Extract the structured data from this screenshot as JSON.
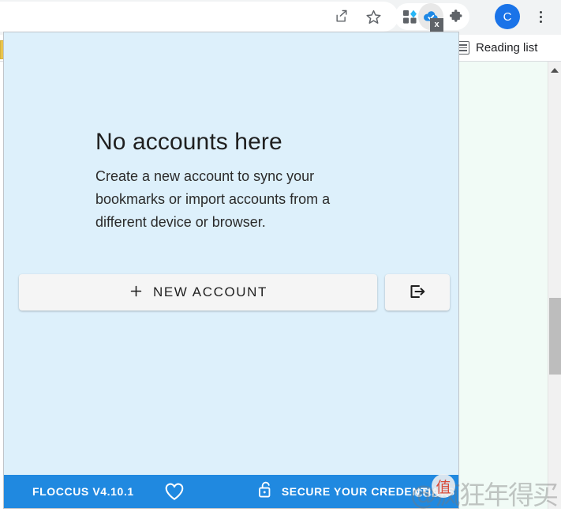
{
  "browser": {
    "toolbar": {
      "share_icon": "share-icon",
      "bookmark_star_icon": "star-icon",
      "apps_grid_icon": "apps-grid-icon",
      "floccus_extension_icon": "floccus-cloud-check-icon",
      "floccus_badge_text": "x",
      "extensions_puzzle_icon": "puzzle-icon",
      "profile_avatar_initial": "C",
      "menu_icon": "kebab-menu-icon"
    },
    "bookmarks_bar": {
      "reading_list_label": "Reading list",
      "reading_list_icon": "list-icon"
    },
    "scrollbar": {
      "up_arrow_icon": "triangle-up-icon"
    }
  },
  "popup": {
    "empty_state": {
      "title": "No accounts here",
      "description": "Create a new account to sync your bookmarks or import accounts from a different device or browser."
    },
    "actions": {
      "new_account_label": "NEW ACCOUNT",
      "new_account_icon": "plus-icon",
      "import_icon": "import-export-arrow-icon"
    },
    "footer": {
      "version_label": "FLOCCUS V4.10.1",
      "donate_icon": "heart-icon",
      "secure_label": "SECURE YOUR CREDENTIALS",
      "secure_icon": "unlocked-padlock-icon",
      "background_color": "#2089e0"
    },
    "background_color": "#ddf0fb"
  },
  "watermark": {
    "site": "CSDN",
    "badge_char": "值",
    "handle": "@疯狂年得买"
  }
}
